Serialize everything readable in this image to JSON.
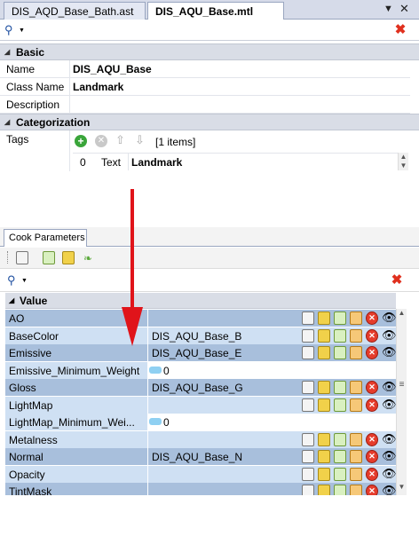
{
  "tabs": [
    {
      "label": "DIS_AQD_Base_Bath.ast"
    },
    {
      "label": "DIS_AQU_Base.mtl"
    }
  ],
  "sections": {
    "basic": "Basic",
    "categorization": "Categorization"
  },
  "properties": [
    {
      "key": "Name",
      "value": "DIS_AQU_Base"
    },
    {
      "key": "Class Name",
      "value": "Landmark"
    },
    {
      "key": "Description",
      "value": ""
    }
  ],
  "tags": {
    "label": "Tags",
    "count_text": "[1 items]",
    "row": {
      "index": "0",
      "type": "Text",
      "value": "Landmark"
    }
  },
  "lower_tab": {
    "label": "Cook Parameters"
  },
  "grid": {
    "header": "Value",
    "rows": [
      {
        "name": "AO",
        "value": "",
        "kind": "texture"
      },
      {
        "name": "BaseColor",
        "value": "DIS_AQU_Base_B",
        "kind": "texture"
      },
      {
        "name": "Emissive",
        "value": "DIS_AQU_Base_E",
        "kind": "texture"
      },
      {
        "name": "Emissive_Minimum_Weight",
        "value": "0",
        "kind": "number"
      },
      {
        "name": "Gloss",
        "value": "DIS_AQU_Base_G",
        "kind": "texture"
      },
      {
        "name": "LightMap",
        "value": "",
        "kind": "texture"
      },
      {
        "name": "LightMap_Minimum_Wei...",
        "value": "0",
        "kind": "number"
      },
      {
        "name": "Metalness",
        "value": "",
        "kind": "texture"
      },
      {
        "name": "Normal",
        "value": "DIS_AQU_Base_N",
        "kind": "texture"
      },
      {
        "name": "Opacity",
        "value": "",
        "kind": "texture"
      },
      {
        "name": "TintMask",
        "value": "",
        "kind": "texture"
      }
    ]
  },
  "colors": {
    "annotation_arrow": "#e0141a",
    "row_dark": "#a8bfdc",
    "row_light": "#cfe0f3"
  },
  "icons": {
    "search": "search-icon",
    "clear": "clear-icon",
    "add": "add-icon",
    "remove": "remove-icon",
    "up": "arrow-up-icon",
    "down": "arrow-down-icon"
  }
}
